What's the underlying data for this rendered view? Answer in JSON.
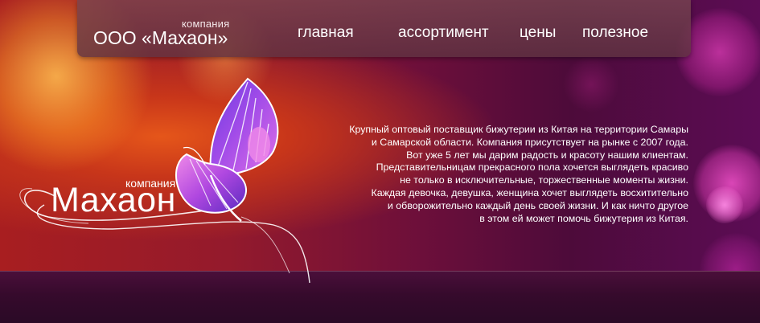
{
  "header": {
    "company_small": "компания",
    "title": "ООО «Махаон»",
    "nav": [
      {
        "label": "главная"
      },
      {
        "label": "ассортимент"
      },
      {
        "label": "цены"
      },
      {
        "label": "полезное"
      }
    ]
  },
  "logo": {
    "company_small": "компания",
    "title": "Махаон",
    "icon": "butterfly-icon"
  },
  "description": {
    "lines": [
      "Крупный оптовый поставщик бижутерии из Китая на территории Самары",
      "и Самарской области. Компания присутствует  на рынке с 2007 года.",
      "Вот уже 5 лет мы дарим радость и красоту нашим клиентам.",
      "Представительницам прекрасного пола хочется выглядеть красиво",
      "не только в исключительные, торжественные моменты жизни.",
      "Каждая девочка, девушка, женщина хочет выглядеть восхитительно",
      "и обворожительно каждый день своей жизни.  И как ничто другое",
      "в этом ей может помочь бижутерия из Китая."
    ]
  },
  "colors": {
    "background_warm": "#c8361a",
    "background_purple": "#5c0c55",
    "header_panel": "#7a4450",
    "butterfly_violet": "#8a3cdc",
    "butterfly_pink": "#e060e0",
    "text": "#ffffff"
  }
}
